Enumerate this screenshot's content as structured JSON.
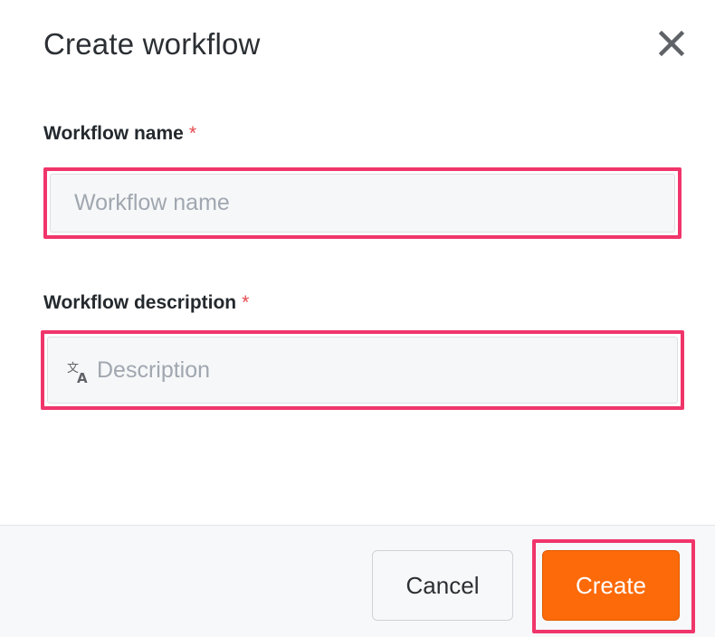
{
  "dialog": {
    "title": "Create workflow",
    "close_icon": "close-icon"
  },
  "fields": {
    "name": {
      "label": "Workflow name",
      "required_marker": "*",
      "value": "",
      "placeholder": "Workflow name"
    },
    "description": {
      "label": "Workflow description",
      "required_marker": "*",
      "value": "",
      "placeholder": "Description",
      "icon": "translate-icon"
    }
  },
  "footer": {
    "cancel_label": "Cancel",
    "create_label": "Create"
  },
  "colors": {
    "accent": "#fc6a0a",
    "highlight": "#f0356b",
    "required": "#e5484d"
  }
}
